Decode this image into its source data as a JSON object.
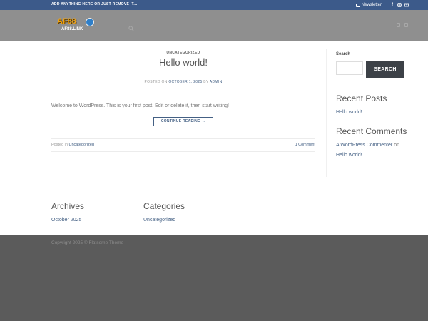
{
  "topbar": {
    "message": "ADD ANYTHING HERE OR JUST REMOVE IT...",
    "newsletter": "Newsletter",
    "social": [
      "f",
      "ig",
      "@"
    ]
  },
  "header": {
    "logo_text": "AF88",
    "logo_sub": "AF88.LINK"
  },
  "post": {
    "category": "UNCATEGORIZED",
    "title": "Hello world!",
    "posted_on": "POSTED ON",
    "date": "OCTOBER 1, 2025",
    "by": "BY",
    "author": "ADMIN",
    "body": "Welcome to WordPress. This is your first post. Edit or delete it, then start writing!",
    "continue": "CONTINUE READING →",
    "posted_in": "Posted in",
    "posted_cat": "Uncategorized",
    "comments": "1 Comment"
  },
  "sidebar": {
    "search_label": "Search",
    "search_button": "SEARCH",
    "recent_posts_title": "Recent Posts",
    "recent_post": "Hello world!",
    "recent_comments_title": "Recent Comments",
    "comment_author": "A WordPress Commenter",
    "comment_on": "on",
    "comment_post": "Hello world!"
  },
  "footer": {
    "archives_title": "Archives",
    "archive_item": "October 2025",
    "categories_title": "Categories",
    "category_item": "Uncategorized",
    "copyright": "Copyright 2025 © Flatsome Theme"
  },
  "colors": {
    "topbar": "#3c5a8a",
    "link": "#446084",
    "button": "#3c4147"
  }
}
